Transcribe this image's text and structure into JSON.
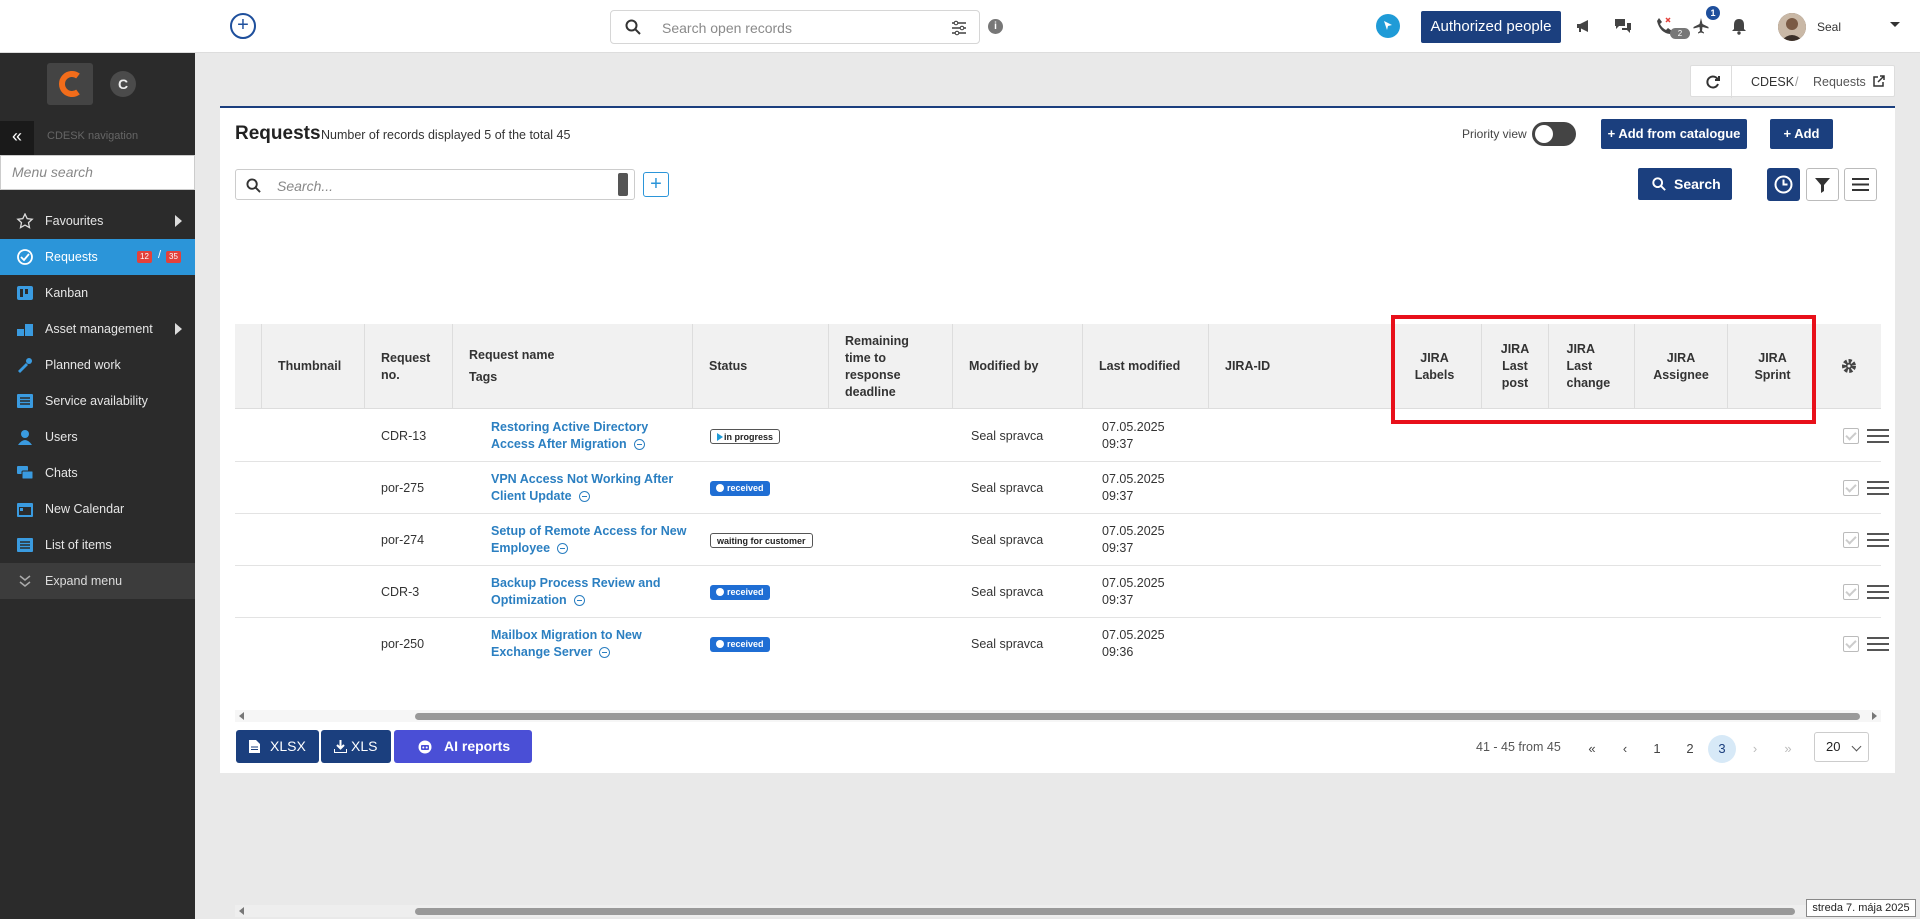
{
  "topbar": {
    "search_placeholder": "Search open records",
    "info_label": "i",
    "authorized_people_label": "Authorized people",
    "notification_badge": "1",
    "call_badge": "2",
    "user_name": "Seal"
  },
  "sidebar": {
    "logo_letter": "C",
    "nav_title": "CDESK navigation",
    "menu_search_placeholder": "Menu search",
    "items": [
      {
        "label": "Favourites",
        "icon": "star-icon",
        "submenu": true
      },
      {
        "label": "Requests",
        "icon": "requests-icon",
        "active": true,
        "badge_red": "12",
        "badge_sep": "/",
        "badge_total": "35"
      },
      {
        "label": "Kanban",
        "icon": "kanban-icon"
      },
      {
        "label": "Asset management",
        "icon": "asset-icon",
        "submenu": true
      },
      {
        "label": "Planned work",
        "icon": "planned-work-icon"
      },
      {
        "label": "Service availability",
        "icon": "list-icon"
      },
      {
        "label": "Users",
        "icon": "user-icon"
      },
      {
        "label": "Chats",
        "icon": "chat-icon"
      },
      {
        "label": "New Calendar",
        "icon": "calendar-icon"
      },
      {
        "label": "List of items",
        "icon": "list-icon"
      },
      {
        "label": "Expand menu",
        "icon": "expand-icon"
      }
    ]
  },
  "breadcrumb": {
    "root": "CDESK",
    "separator": "/",
    "current": "Requests"
  },
  "page": {
    "title": "Requests",
    "subtitle": "Number of records displayed 5 of the total 45",
    "priority_view_label": "Priority view",
    "add_from_catalogue_label": "+ Add from catalogue",
    "add_label": "+ Add",
    "search_placeholder": "Search...",
    "search_button_label": "Search"
  },
  "table": {
    "headers": {
      "thumbnail": "Thumbnail",
      "request_no": "Request no.",
      "request_name": "Request name",
      "tags": "Tags",
      "status": "Status",
      "remaining": "Remaining time to response deadline",
      "modified_by": "Modified by",
      "last_modified": "Last modified",
      "jira_id": "JIRA-ID",
      "jira_labels": "JIRA Labels",
      "jira_last_post": "JIRA Last post",
      "jira_last_change": "JIRA Last change",
      "jira_assignee": "JIRA Assignee",
      "jira_sprint": "JIRA Sprint"
    },
    "rows": [
      {
        "no": "CDR-13",
        "name": "Restoring Active Directory Access After Migration",
        "status": "in progress",
        "status_style": "white-play",
        "modified_by": "Seal spravca",
        "date": "07.05.2025",
        "time": "09:37"
      },
      {
        "no": "por-275",
        "name": "VPN Access Not Working After Client Update",
        "status": "received",
        "status_style": "blue",
        "modified_by": "Seal spravca",
        "date": "07.05.2025",
        "time": "09:37"
      },
      {
        "no": "por-274",
        "name": "Setup of Remote Access for New Employee",
        "status": "waiting for customer",
        "status_style": "white",
        "modified_by": "Seal spravca",
        "date": "07.05.2025",
        "time": "09:37"
      },
      {
        "no": "CDR-3",
        "name": "Backup Process Review and Optimization",
        "status": "received",
        "status_style": "blue",
        "modified_by": "Seal spravca",
        "date": "07.05.2025",
        "time": "09:37"
      },
      {
        "no": "por-250",
        "name": "Mailbox Migration to New Exchange Server",
        "status": "received",
        "status_style": "blue",
        "modified_by": "Seal spravca",
        "date": "07.05.2025",
        "time": "09:36"
      }
    ]
  },
  "footer": {
    "xlsx_label": "XLSX",
    "xls_label": "XLS",
    "ai_reports_label": "AI reports",
    "page_info": "41 - 45 from 45",
    "first": "«",
    "prev": "‹",
    "pages": [
      "1",
      "2",
      "3"
    ],
    "current_page": "3",
    "next": "›",
    "last": "»",
    "page_size": "20"
  },
  "status_date": "streda 7. mája 2025",
  "colors": {
    "brand": "#1b3f7e",
    "accent": "#2b95d9",
    "highlight": "#e8101a"
  }
}
